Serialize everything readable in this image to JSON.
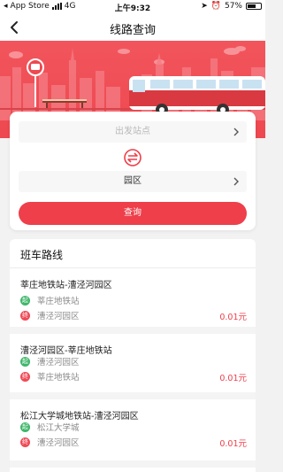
{
  "status_bar": {
    "carrier": "App Store",
    "network": "4G",
    "time": "上午9:32",
    "battery": "57%"
  },
  "nav": {
    "title": "线路查询",
    "back_icon": "chevron-left-icon"
  },
  "hero": {
    "illustration": "city-bus-stop-illustration"
  },
  "search": {
    "from_placeholder": "出发站点",
    "to_value": "园区",
    "swap_icon": "swap-icon",
    "query_label": "查询"
  },
  "routes": {
    "title": "班车路线",
    "start_badge": "起",
    "end_badge": "终",
    "items": [
      {
        "name": "莘庄地铁站-漕泾河园区",
        "start": "莘庄地铁站",
        "end": "漕泾河园区",
        "price": "0.01元"
      },
      {
        "name": "漕泾河园区-莘庄地铁站",
        "start": "漕泾河园区",
        "end": "莘庄地铁站",
        "price": "0.01元"
      },
      {
        "name": "松江大学城地铁站-漕泾河园区",
        "start": "松江大学城",
        "end": "漕泾河园区",
        "price": "0.01元"
      }
    ]
  },
  "colors": {
    "accent": "#ee3f4a",
    "start_green": "#3fb66a"
  }
}
